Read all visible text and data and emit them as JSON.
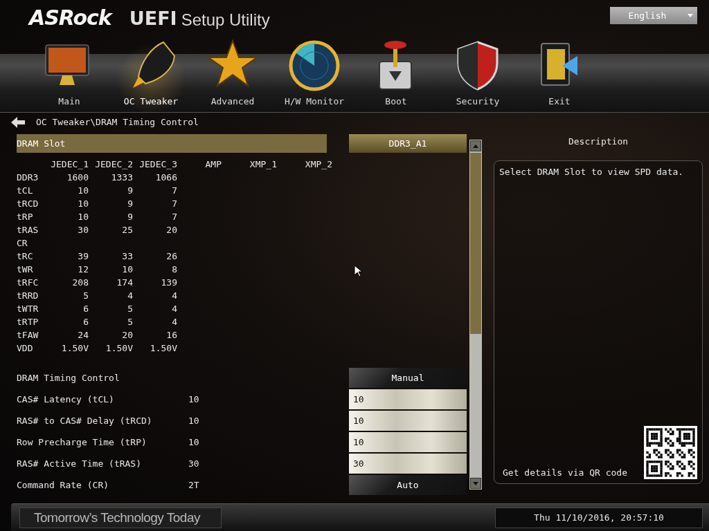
{
  "header": {
    "logo": "ASRock",
    "title_bold": "UEFI",
    "title": "Setup Utility",
    "language": "English"
  },
  "nav": [
    {
      "label": "Main",
      "selected": false
    },
    {
      "label": "OC Tweaker",
      "selected": true
    },
    {
      "label": "Advanced",
      "selected": false
    },
    {
      "label": "H/W Monitor",
      "selected": false
    },
    {
      "label": "Boot",
      "selected": false
    },
    {
      "label": "Security",
      "selected": false
    },
    {
      "label": "Exit",
      "selected": false
    }
  ],
  "breadcrumb": "OC Tweaker\\DRAM Timing Control",
  "dram_slot": {
    "label": "DRAM Slot",
    "value": "DDR3_A1"
  },
  "spd_table": {
    "columns": [
      "JEDEC_1",
      "JEDEC_2",
      "JEDEC_3",
      "AMP",
      "XMP_1",
      "XMP_2"
    ],
    "rows": [
      {
        "label": "DDR3",
        "values": [
          "1600",
          "1333",
          "1066"
        ]
      },
      {
        "label": "tCL",
        "values": [
          "10",
          "9",
          "7"
        ]
      },
      {
        "label": "tRCD",
        "values": [
          "10",
          "9",
          "7"
        ]
      },
      {
        "label": "tRP",
        "values": [
          "10",
          "9",
          "7"
        ]
      },
      {
        "label": "tRAS",
        "values": [
          "30",
          "25",
          "20"
        ]
      },
      {
        "label": "CR"
      },
      {
        "label": "tRC",
        "values": [
          "39",
          "33",
          "26"
        ]
      },
      {
        "label": "tWR",
        "values": [
          "12",
          "10",
          "8"
        ]
      },
      {
        "label": "tRFC",
        "values": [
          "208",
          "174",
          "139"
        ]
      },
      {
        "label": "tRRD",
        "values": [
          "5",
          "4",
          "4"
        ]
      },
      {
        "label": "tWTR",
        "values": [
          "6",
          "5",
          "4"
        ]
      },
      {
        "label": "tRTP",
        "values": [
          "6",
          "5",
          "4"
        ]
      },
      {
        "label": "tFAW",
        "values": [
          "24",
          "20",
          "16"
        ]
      },
      {
        "label": "VDD",
        "values": [
          "1.50V",
          "1.50V",
          "1.50V"
        ]
      }
    ]
  },
  "timing": [
    {
      "label": "DRAM Timing Control",
      "control": {
        "kind": "dropdown",
        "text": "Manual"
      }
    },
    {
      "label": "CAS# Latency (tCL)",
      "value": "10",
      "control": {
        "kind": "field",
        "text": "10"
      }
    },
    {
      "label": "RAS# to CAS# Delay (tRCD)",
      "value": "10",
      "control": {
        "kind": "field",
        "text": "10"
      }
    },
    {
      "label": "Row Precharge Time (tRP)",
      "value": "10",
      "control": {
        "kind": "field",
        "text": "10"
      }
    },
    {
      "label": "RAS# Active Time (tRAS)",
      "value": "30",
      "control": {
        "kind": "field",
        "text": "30"
      }
    },
    {
      "label": "Command Rate (CR)",
      "value": "2T",
      "control": {
        "kind": "dropdown",
        "text": "Auto"
      }
    }
  ],
  "description": {
    "title": "Description",
    "text": "Select DRAM Slot to view SPD data.",
    "qr_caption": "Get details via QR code"
  },
  "footer": {
    "tagline": "Tomorrow’s Technology Today",
    "datetime": "Thu 11/10/2016, 20:57:10"
  }
}
